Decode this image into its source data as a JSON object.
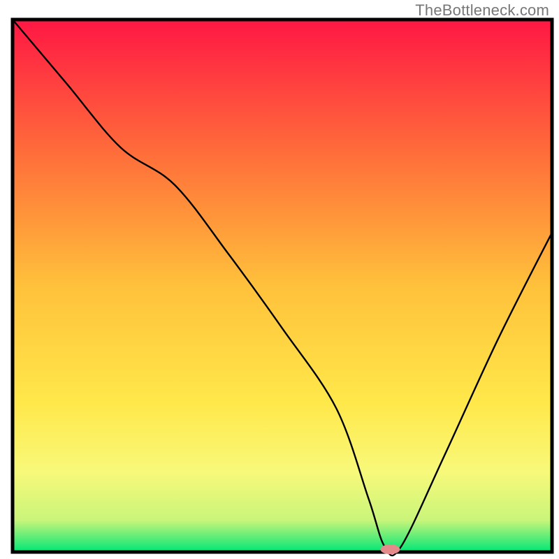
{
  "watermark": "TheBottleneck.com",
  "chart_data": {
    "type": "line",
    "title": "",
    "xlabel": "",
    "ylabel": "",
    "xlim": [
      0,
      100
    ],
    "ylim": [
      0,
      100
    ],
    "background_gradient": {
      "stops": [
        {
          "offset": 0,
          "color": "#ff1744"
        },
        {
          "offset": 25,
          "color": "#ff6d3a"
        },
        {
          "offset": 50,
          "color": "#ffc13b"
        },
        {
          "offset": 72,
          "color": "#ffe84a"
        },
        {
          "offset": 85,
          "color": "#f8f97a"
        },
        {
          "offset": 94,
          "color": "#c9f57a"
        },
        {
          "offset": 100,
          "color": "#00e676"
        }
      ]
    },
    "series": [
      {
        "name": "bottleneck-curve",
        "x": [
          0,
          10,
          20,
          30,
          40,
          50,
          60,
          66,
          69,
          72,
          80,
          90,
          100
        ],
        "y": [
          100,
          88,
          76,
          69,
          56,
          42,
          27,
          10,
          1,
          1,
          18,
          40,
          60
        ]
      }
    ],
    "marker": {
      "name": "optimal-point",
      "x": 70,
      "y": 0.5,
      "color": "#e58a8a",
      "rx": 14,
      "ry": 7
    },
    "axes": {
      "frame_color": "#000000",
      "frame_width": 5
    }
  }
}
